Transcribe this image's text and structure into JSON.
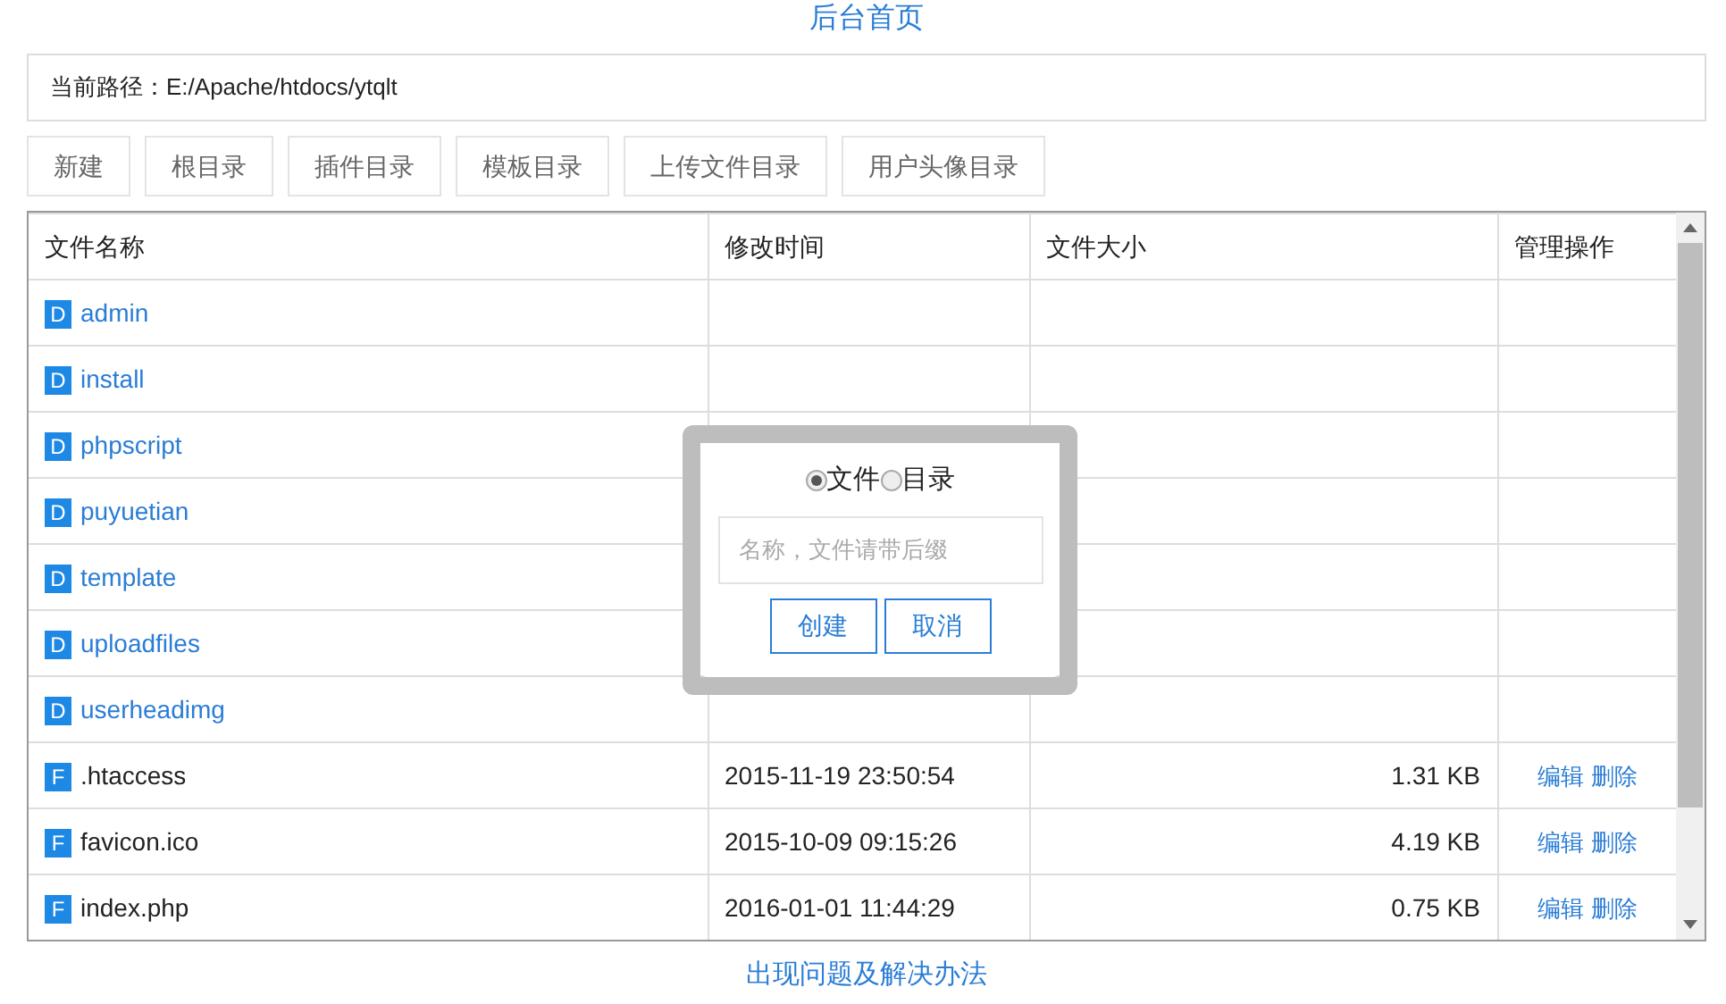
{
  "header_link": "后台首页",
  "path": {
    "label": "当前路径：",
    "value": "E:/Apache/htdocs/ytqlt"
  },
  "toolbar": [
    "新建",
    "根目录",
    "插件目录",
    "模板目录",
    "上传文件目录",
    "用户头像目录"
  ],
  "table": {
    "columns": [
      "文件名称",
      "修改时间",
      "文件大小",
      "管理操作"
    ],
    "rows": [
      {
        "kind": "dir",
        "badge": "D",
        "name": "admin"
      },
      {
        "kind": "dir",
        "badge": "D",
        "name": "install"
      },
      {
        "kind": "dir",
        "badge": "D",
        "name": "phpscript"
      },
      {
        "kind": "dir",
        "badge": "D",
        "name": "puyuetian"
      },
      {
        "kind": "dir",
        "badge": "D",
        "name": "template"
      },
      {
        "kind": "dir",
        "badge": "D",
        "name": "uploadfiles"
      },
      {
        "kind": "dir",
        "badge": "D",
        "name": "userheadimg"
      },
      {
        "kind": "file",
        "badge": "F",
        "name": ".htaccess",
        "modified": "2015-11-19 23:50:54",
        "size": "1.31 KB",
        "actions": [
          "编辑",
          "删除"
        ]
      },
      {
        "kind": "file",
        "badge": "F",
        "name": "favicon.ico",
        "modified": "2015-10-09 09:15:26",
        "size": "4.19 KB",
        "actions": [
          "编辑",
          "删除"
        ]
      },
      {
        "kind": "file",
        "badge": "F",
        "name": "index.php",
        "modified": "2016-01-01 11:44:29",
        "size": "0.75 KB",
        "actions": [
          "编辑",
          "删除"
        ]
      }
    ]
  },
  "dialog": {
    "options": [
      {
        "label": "文件",
        "selected": true
      },
      {
        "label": "目录",
        "selected": false
      }
    ],
    "name_field": {
      "placeholder": "名称，文件请带后缀"
    },
    "buttons": [
      "创建",
      "取消"
    ]
  },
  "footer_link": "出现问题及解决办法"
}
